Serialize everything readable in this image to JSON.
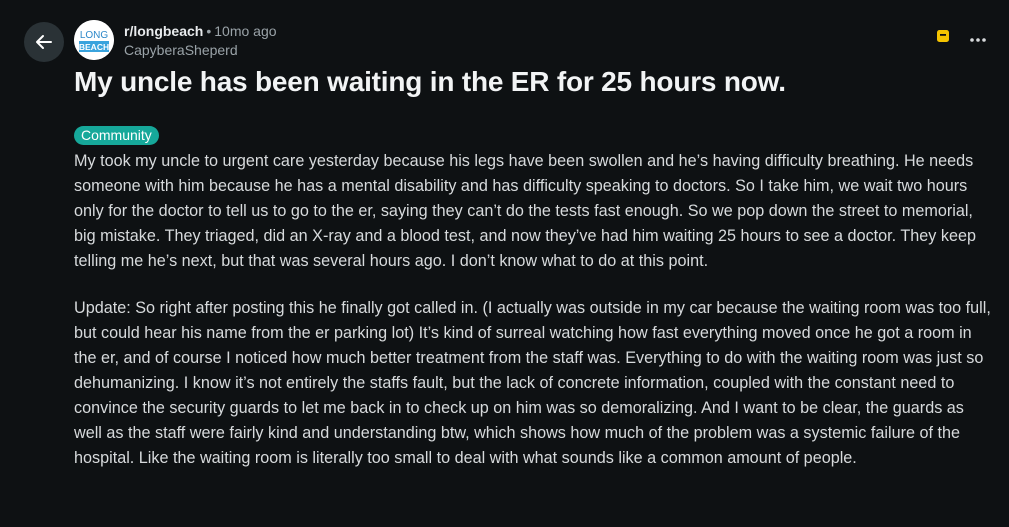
{
  "post": {
    "subreddit": "r/longbeach",
    "separator": "•",
    "age": "10mo ago",
    "author": "CapyberaSheperd",
    "avatar_text_top": "LONG",
    "avatar_text_bottom": "BEACH",
    "title": "My uncle has been waiting in the ER for 25 hours now.",
    "flair": "Community",
    "paragraphs": [
      "My took my uncle to urgent care yesterday because his legs have been swollen and he’s having difficulty breathing. He needs someone with him because he has a mental disability and has difficulty speaking to doctors. So I take him, we wait two hours only for the doctor to tell us to go to the er, saying they can’t do the tests fast enough. So we pop down the street to memorial, big mistake. They triaged, did an X-ray and a blood test, and now they’ve had him waiting 25 hours to see a doctor. They keep telling me he’s next, but that was several hours ago. I don’t know what to do at this point.",
      "Update: So right after posting this he finally got called in. (I actually was outside in my car because the waiting room was too full, but could hear his name from the er parking lot) It’s kind of surreal watching how fast everything moved once he got a room in the er, and of course I noticed how much better treatment from the staff was. Everything to do with the waiting room was just so dehumanizing. I know it’s not entirely the staffs fault, but the lack of concrete information, coupled with the constant need to convince the security guards to let me back in to check up on him was so demoralizing. And I want to be clear, the guards as well as the staff were fairly kind and understanding btw, which shows how much of the problem was a systemic failure of the hospital. Like the waiting room is literally too small to deal with what sounds like a common amount of people."
    ]
  },
  "icons": {
    "back": "arrow-left-icon",
    "save": "bookmark-icon",
    "more": "more-horizontal-icon"
  },
  "colors": {
    "background": "#0e1113",
    "flair_bg": "#16a89a",
    "save_icon": "#f5c400"
  }
}
